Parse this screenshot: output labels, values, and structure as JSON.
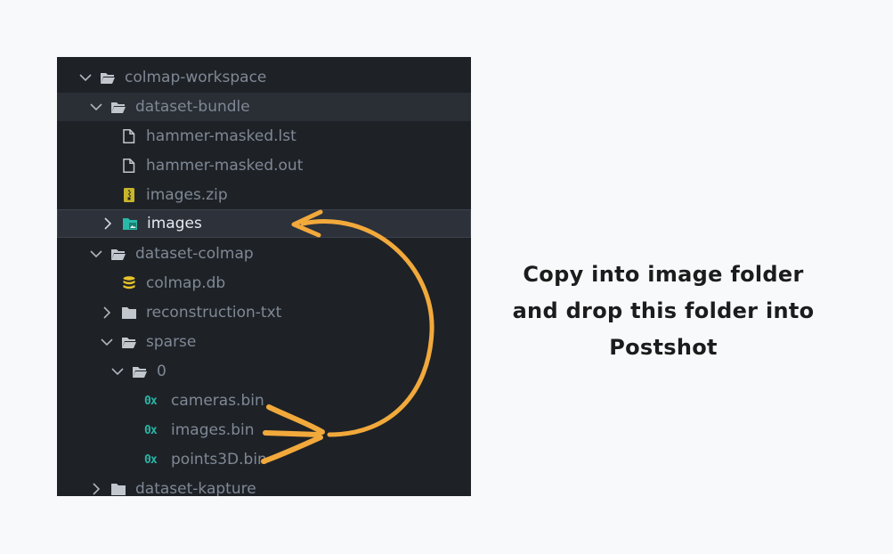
{
  "explorer": {
    "rows": [
      {
        "label": "colmap-workspace",
        "icon": "folder-open-icon"
      },
      {
        "label": "dataset-bundle",
        "icon": "folder-open-icon"
      },
      {
        "label": "hammer-masked.lst",
        "icon": "file-icon"
      },
      {
        "label": "hammer-masked.out",
        "icon": "file-icon"
      },
      {
        "label": "images.zip",
        "icon": "zip-icon"
      },
      {
        "label": "images",
        "icon": "image-folder-icon"
      },
      {
        "label": "dataset-colmap",
        "icon": "folder-open-icon"
      },
      {
        "label": "colmap.db",
        "icon": "database-icon"
      },
      {
        "label": "reconstruction-txt",
        "icon": "folder-icon"
      },
      {
        "label": "sparse",
        "icon": "folder-open-icon"
      },
      {
        "label": "0",
        "icon": "folder-open-icon"
      },
      {
        "label": "cameras.bin",
        "icon": "binary-icon",
        "icon_text": "0x"
      },
      {
        "label": "images.bin",
        "icon": "binary-icon",
        "icon_text": "0x"
      },
      {
        "label": "points3D.bin",
        "icon": "binary-icon",
        "icon_text": "0x"
      },
      {
        "label": "dataset-kapture",
        "icon": "folder-icon"
      }
    ]
  },
  "annotation": {
    "lines": [
      "Copy into image folder",
      "and drop this folder into",
      "Postshot"
    ]
  },
  "colors": {
    "arrow": "#f2a93b",
    "explorer_bg": "#1e2227",
    "zip_icon": "#c9b52b",
    "db_icon": "#e8c229",
    "binary_icon": "#2bb5a6",
    "image_folder_icon": "#29b9a8"
  }
}
